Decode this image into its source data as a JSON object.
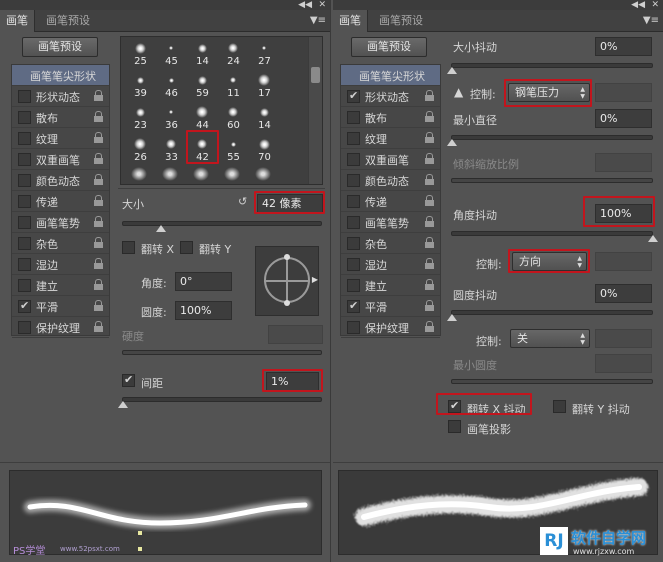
{
  "left": {
    "tabs": [
      "画笔",
      "画笔预设"
    ],
    "preset_button": "画笔预设",
    "list_items": [
      {
        "label": "画笔笔尖形状",
        "checked": false
      },
      {
        "label": "形状动态",
        "checked": false
      },
      {
        "label": "散布",
        "checked": false
      },
      {
        "label": "纹理",
        "checked": false
      },
      {
        "label": "双重画笔",
        "checked": false
      },
      {
        "label": "颜色动态",
        "checked": false
      },
      {
        "label": "传递",
        "checked": false
      },
      {
        "label": "画笔笔势",
        "checked": false
      },
      {
        "label": "杂色",
        "checked": false
      },
      {
        "label": "湿边",
        "checked": false
      },
      {
        "label": "建立",
        "checked": false
      },
      {
        "label": "平滑",
        "checked": true
      },
      {
        "label": "保护纹理",
        "checked": false
      }
    ],
    "brush_sizes": [
      "25",
      "45",
      "14",
      "24",
      "27",
      "39",
      "46",
      "59",
      "11",
      "17",
      "23",
      "36",
      "44",
      "60",
      "14",
      "26",
      "33",
      "42",
      "55",
      "70"
    ],
    "size_label": "大小",
    "size_value": "42 像素",
    "flip_x": "翻转 X",
    "flip_y": "翻转 Y",
    "angle_label": "角度:",
    "angle_value": "0°",
    "roundness_label": "圆度:",
    "roundness_value": "100%",
    "hardness_label": "硬度",
    "spacing_label": "间距",
    "spacing_value": "1%",
    "spacing_checked": true,
    "watermark_left": "PS学堂",
    "watermark_url": "www.52psxt.com"
  },
  "right": {
    "tabs": [
      "画笔",
      "画笔预设"
    ],
    "preset_button": "画笔预设",
    "list_items": [
      {
        "label": "画笔笔尖形状",
        "checked": false
      },
      {
        "label": "形状动态",
        "checked": true
      },
      {
        "label": "散布",
        "checked": false
      },
      {
        "label": "纹理",
        "checked": false
      },
      {
        "label": "双重画笔",
        "checked": false
      },
      {
        "label": "颜色动态",
        "checked": false
      },
      {
        "label": "传递",
        "checked": false
      },
      {
        "label": "画笔笔势",
        "checked": false
      },
      {
        "label": "杂色",
        "checked": false
      },
      {
        "label": "湿边",
        "checked": false
      },
      {
        "label": "建立",
        "checked": false
      },
      {
        "label": "平滑",
        "checked": true
      },
      {
        "label": "保护纹理",
        "checked": false
      }
    ],
    "size_jitter_label": "大小抖动",
    "size_jitter_value": "0%",
    "control_label": "控制:",
    "control1_value": "钢笔压力",
    "min_diameter_label": "最小直径",
    "min_diameter_value": "0%",
    "tilt_scale_label": "倾斜缩放比例",
    "angle_jitter_label": "角度抖动",
    "angle_jitter_value": "100%",
    "control2_value": "方向",
    "roundness_jitter_label": "圆度抖动",
    "roundness_jitter_value": "0%",
    "control3_value": "关",
    "min_roundness_label": "最小圆度",
    "flip_x_jitter": "翻转 X 抖动",
    "flip_y_jitter": "翻转 Y 抖动",
    "brush_projection": "画笔投影",
    "logo_letters": "RJ",
    "logo_text": "软件自学网",
    "logo_url": "www.rjzxw.com"
  },
  "colors": {
    "highlight": "#c2151d",
    "selection": "#5f6b84",
    "logo_blue": "#2a8fd6"
  }
}
